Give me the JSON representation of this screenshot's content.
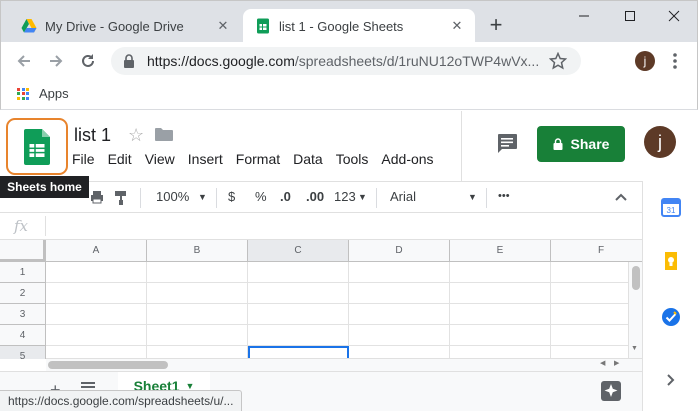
{
  "browser": {
    "tabs": [
      {
        "title": "My Drive - Google Drive",
        "icon": "google-drive-icon",
        "active": false
      },
      {
        "title": "list 1 - Google Sheets",
        "icon": "google-sheets-icon",
        "active": true
      }
    ],
    "url_host": "https://docs.google.com",
    "url_rest": "/spreadsheets/d/1ruNU12oTWP4wVx...",
    "profile_initial": "j",
    "bookmarks": {
      "apps_label": "Apps"
    }
  },
  "sheets": {
    "doc_title": "list 1",
    "menus": [
      "File",
      "Edit",
      "View",
      "Insert",
      "Format",
      "Data",
      "Tools",
      "Add-ons"
    ],
    "share_label": "Share",
    "account_initial": "j",
    "tooltip": "Sheets home",
    "toolbar": {
      "zoom": "100%",
      "currency": "$",
      "percent": "%",
      "dec_decrease": ".0",
      "dec_increase": ".00",
      "more_formats": "123",
      "font": "Arial",
      "more": "•••"
    },
    "fx_label": "fx",
    "columns": [
      "A",
      "B",
      "C",
      "D",
      "E",
      "F"
    ],
    "rows": [
      "1",
      "2",
      "3",
      "4",
      "5"
    ],
    "active_cell": "C5",
    "sheet_tab": "Sheet1",
    "status_url": "https://docs.google.com/spreadsheets/u/..."
  },
  "colors": {
    "sheets_green": "#188038",
    "highlight_orange": "#e8842d",
    "selection_blue": "#1a73e8"
  }
}
